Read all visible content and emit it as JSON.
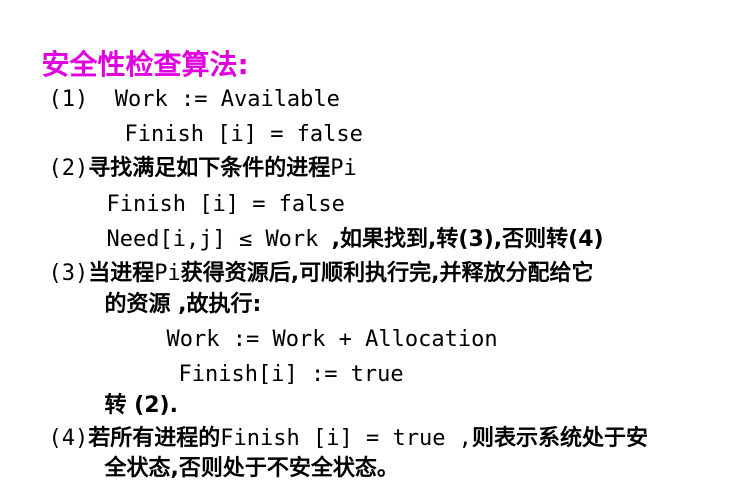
{
  "colors": {
    "title": "#e000e0",
    "text": "#000000",
    "background": "#ffffff"
  },
  "title": "安全性检查算法:",
  "step1": {
    "num": "(1)",
    "line1": "Work := Available",
    "line2": "Finish [i] = false"
  },
  "step2": {
    "num": "(2)",
    "heading": "寻找满足如下条件的进程",
    "heading_tail": "Pi",
    "cond1": "Finish [i] = false",
    "cond2_code": "Need[i,j] ≤ Work ",
    "cond2_text": ",如果找到,转(3),否则转(4)"
  },
  "step3": {
    "num": "(3)",
    "text_a1": "当进程",
    "text_a2": "Pi",
    "text_a3": "获得资源后,可顺利执行完,并释放分配给它",
    "text_b": "的资源 ,故执行:",
    "code1": "Work := Work + Allocation",
    "code2": "Finish[i] := true",
    "goto": "转 (2)."
  },
  "step4": {
    "num": "(4)",
    "text_a1": "若所有进程的",
    "text_a2": "Finish [i] = true ,",
    "text_a3": "则表示系统处于安",
    "text_b": "全状态,否则处于不安全状态。"
  }
}
